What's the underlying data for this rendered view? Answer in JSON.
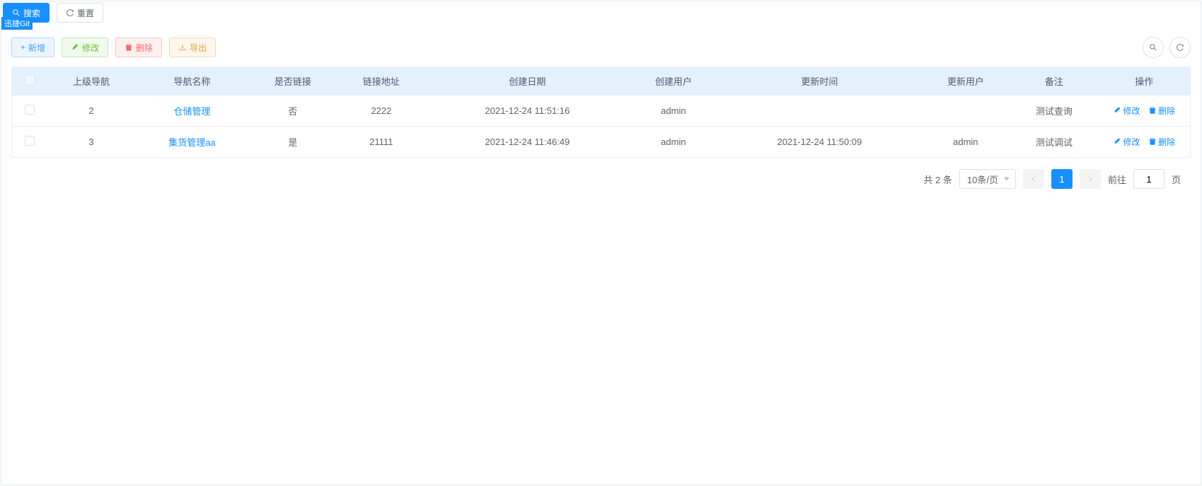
{
  "topbar": {
    "search_label": "搜索",
    "reset_label": "重置",
    "logo_text": "迅捷Git"
  },
  "toolbar": {
    "add_label": "新增",
    "edit_label": "修改",
    "delete_label": "删除",
    "export_label": "导出"
  },
  "table": {
    "headers": {
      "parent_nav": "上级导航",
      "nav_name": "导航名称",
      "is_link": "是否链接",
      "link_url": "链接地址",
      "create_date": "创建日期",
      "create_user": "创建用户",
      "update_time": "更新时间",
      "update_user": "更新用户",
      "remark": "备注",
      "operation": "操作"
    },
    "rows": [
      {
        "parent_nav": "2",
        "nav_name": "仓储管理",
        "is_link": "否",
        "link_url": "2222",
        "create_date": "2021-12-24 11:51:16",
        "create_user": "admin",
        "update_time": "",
        "update_user": "",
        "remark": "测试查询"
      },
      {
        "parent_nav": "3",
        "nav_name": "集货管理aa",
        "is_link": "是",
        "link_url": "21111",
        "create_date": "2021-12-24 11:46:49",
        "create_user": "admin",
        "update_time": "2021-12-24 11:50:09",
        "update_user": "admin",
        "remark": "测试调试"
      }
    ],
    "row_actions": {
      "edit": "修改",
      "delete": "删除"
    }
  },
  "pagination": {
    "total_text": "共 2 条",
    "page_size": "10条/页",
    "current_page": "1",
    "goto_prefix": "前往",
    "goto_suffix": "页",
    "goto_value": "1"
  }
}
